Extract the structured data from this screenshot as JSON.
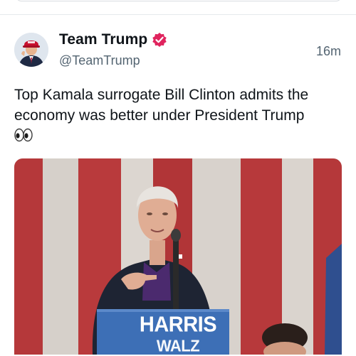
{
  "post": {
    "display_name": "Team Trump",
    "handle": "@TeamTrump",
    "timestamp": "16m",
    "text": "Top Kamala surrogate Bill Clinton admits the economy was better under President Trump",
    "text_emoji": "eyes-emoji"
  },
  "media": {
    "podium_text": "HARRIS",
    "podium_text_sub": "WALZ"
  },
  "colors": {
    "verified_badge": "#e0245e",
    "handle_gray": "#536471",
    "flag_red": "#b5383a",
    "flag_white": "#d9d3cd",
    "podium_blue": "#3d6fb6"
  },
  "icons": {
    "verified": "verified-badge-icon",
    "eyes": "eyes-emoji"
  }
}
